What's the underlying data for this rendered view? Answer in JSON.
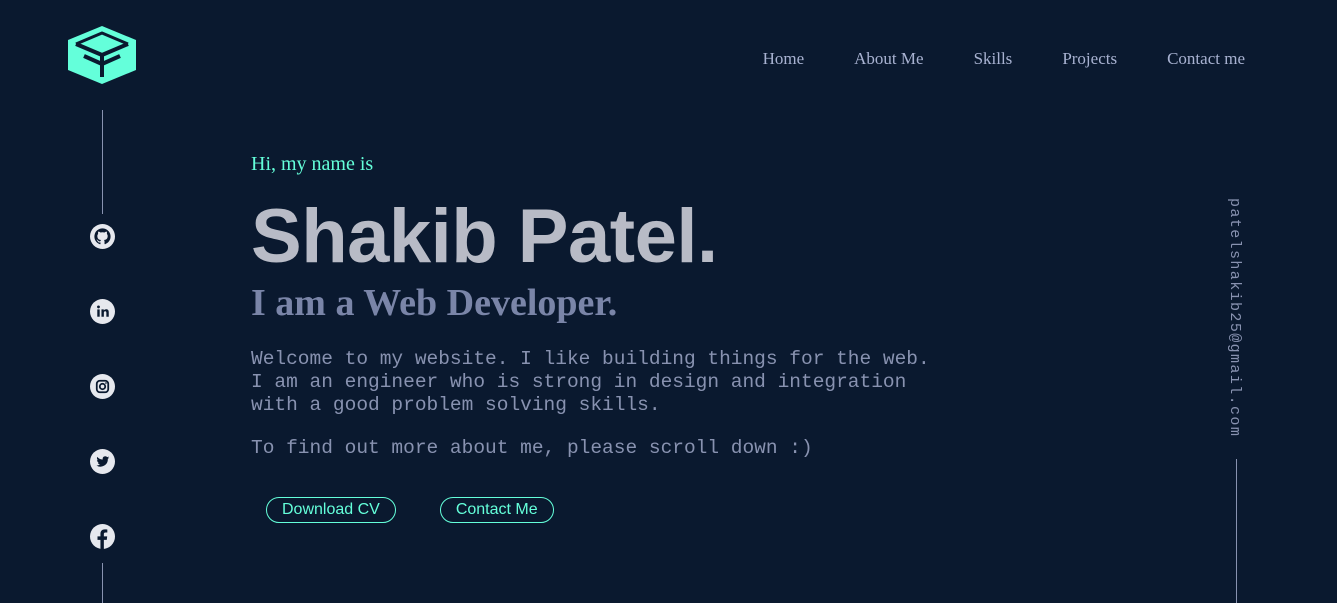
{
  "brand": {
    "logo_icon": "cube-logo-icon",
    "accent": "#64ffda",
    "background": "#0a192f"
  },
  "nav": {
    "items": [
      {
        "label": "Home"
      },
      {
        "label": "About Me"
      },
      {
        "label": "Skills"
      },
      {
        "label": "Projects"
      },
      {
        "label": "Contact me"
      }
    ]
  },
  "social": {
    "icons": [
      "github-icon",
      "linkedin-icon",
      "instagram-icon",
      "twitter-icon",
      "facebook-icon"
    ]
  },
  "hero": {
    "greeting": "Hi, my name is",
    "name": "Shakib Patel.",
    "subtitle": "I am a Web Developer.",
    "intro": "Welcome to my website. I like building things for the web.\nI am an engineer who is strong in design and integration\nwith a good problem solving skills.",
    "scroll_note": "To find out more about me, please scroll down :)",
    "buttons": {
      "download_cv": "Download CV",
      "contact": "Contact Me"
    }
  },
  "side": {
    "email": "patelshakib25@gmail.com"
  }
}
